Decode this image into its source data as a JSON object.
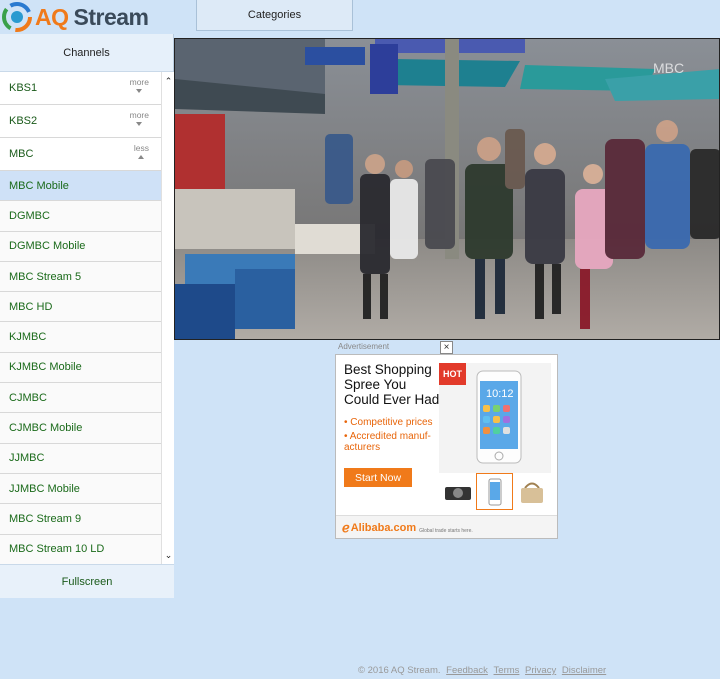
{
  "header": {
    "logo_aq": "AQ",
    "logo_stream": "Stream",
    "categories_label": "Categories"
  },
  "sidebar": {
    "title": "Channels",
    "fullscreen_label": "Fullscreen",
    "items": [
      {
        "label": "KBS1",
        "toggle": "more"
      },
      {
        "label": "KBS2",
        "toggle": "more"
      },
      {
        "label": "MBC",
        "toggle": "less"
      },
      {
        "label": "MBC Mobile"
      },
      {
        "label": "DGMBC"
      },
      {
        "label": "DGMBC Mobile"
      },
      {
        "label": "MBC Stream 5"
      },
      {
        "label": "MBC HD"
      },
      {
        "label": "KJMBC"
      },
      {
        "label": "KJMBC Mobile"
      },
      {
        "label": "CJMBC"
      },
      {
        "label": "CJMBC Mobile"
      },
      {
        "label": "JJMBC"
      },
      {
        "label": "JJMBC Mobile"
      },
      {
        "label": "MBC Stream 9"
      },
      {
        "label": "MBC Stream 10 LD"
      }
    ]
  },
  "video": {
    "watermark": "MBC"
  },
  "ad": {
    "label": "Advertisement",
    "close": "×",
    "title": "Best Shopping Spree You Could Ever Had",
    "badge": "HOT",
    "bullets": [
      "• Competitive prices",
      "• Accredited manuf- acturers"
    ],
    "cta": "Start Now",
    "phone_time": "10:12",
    "brand": "Alibaba.com",
    "tagline": "Global trade starts here."
  },
  "footer": {
    "copyright": "© 2016 AQ Stream.",
    "links": [
      "Feedback",
      "Terms",
      "Privacy",
      "Disclaimer"
    ]
  },
  "colors": {
    "background": "#cfe3f7",
    "accent_orange": "#f07a1a",
    "channel_green": "#1a6a1a",
    "active_row": "#cfe1f7"
  }
}
